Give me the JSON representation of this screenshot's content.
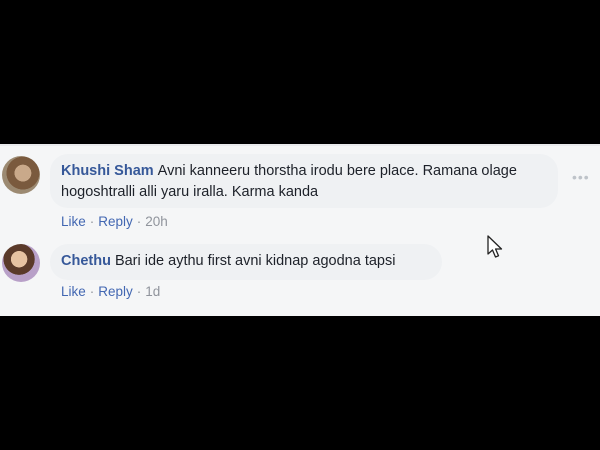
{
  "comments": [
    {
      "author": "Khushi Sham",
      "text": "Avni kanneeru thorstha irodu bere place. Ramana olage hogoshtralli alli yaru iralla. Karma kanda",
      "like_label": "Like",
      "reply_label": "Reply",
      "time": "20h",
      "avatar_icon": "user-avatar-icon"
    },
    {
      "author": "Chethu",
      "text": "Bari ide aythu first avni kidnap agodna tapsi",
      "like_label": "Like",
      "reply_label": "Reply",
      "time": "1d",
      "avatar_icon": "user-avatar-icon"
    }
  ],
  "separator": "·",
  "options_icon": "more-options-icon",
  "cursor_icon": "mouse-pointer-icon",
  "colors": {
    "author": "#365899",
    "link": "#4267b2",
    "meta": "#90949c",
    "bubble": "#eff1f3",
    "panel": "#f5f6f7",
    "letterbox": "#000000"
  }
}
